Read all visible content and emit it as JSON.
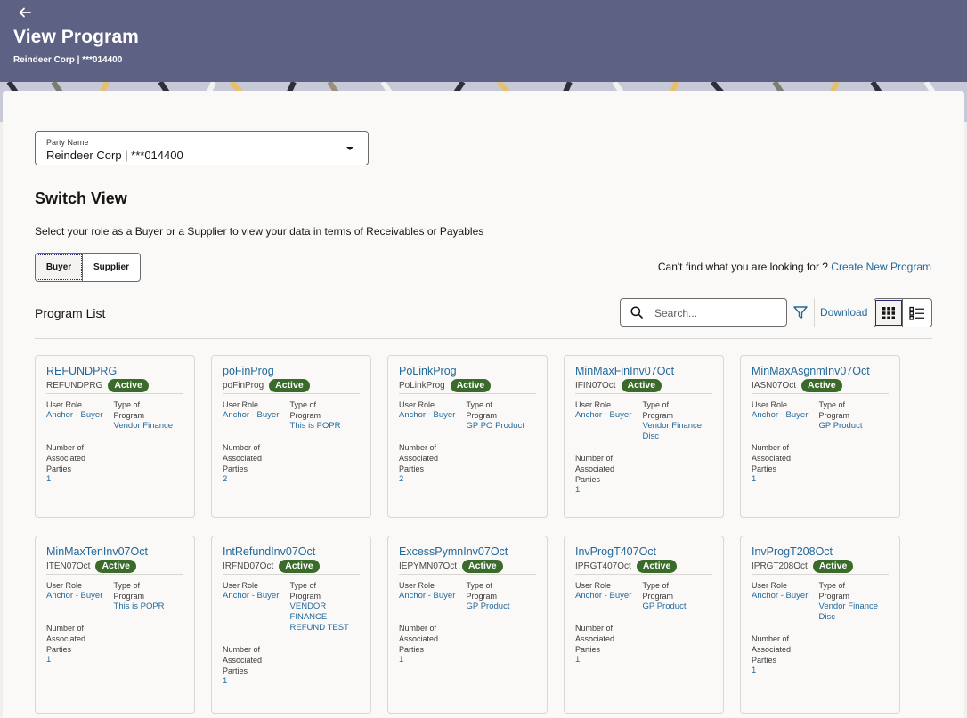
{
  "header": {
    "title": "View Program",
    "subtitle": "Reindeer Corp | ***014400"
  },
  "party": {
    "label": "Party Name",
    "value": "Reindeer Corp | ***014400"
  },
  "switch_view": {
    "title": "Switch View",
    "description": "Select your role as a Buyer or a Supplier to view your data in terms of Receivables or Payables",
    "buyer_label": "Buyer",
    "supplier_label": "Supplier"
  },
  "cant_find": {
    "text": "Can't find what you are looking for ? ",
    "link": "Create New Program"
  },
  "program_list": {
    "title": "Program List",
    "search_placeholder": "Search...",
    "download_label": "Download"
  },
  "labels": {
    "user_role": "User Role",
    "type_line1": "Type of",
    "type_line2": "Program",
    "parties_line1": "Number of",
    "parties_line2": "Associated",
    "parties_line3": "Parties"
  },
  "cards": [
    {
      "name": "REFUNDPRG",
      "code": "REFUNDPRG",
      "status": "Active",
      "role": "Anchor - Buyer",
      "type": "Vendor Finance",
      "parties": "1"
    },
    {
      "name": "poFinProg",
      "code": "poFinProg",
      "status": "Active",
      "role": "Anchor - Buyer",
      "type": "This is POPR",
      "parties": "2"
    },
    {
      "name": "PoLinkProg",
      "code": "PoLinkProg",
      "status": "Active",
      "role": "Anchor - Buyer",
      "type": "GP PO Product",
      "parties": "2"
    },
    {
      "name": "MinMaxFinInv07Oct",
      "code": "IFIN07Oct",
      "status": "Active",
      "role": "Anchor - Buyer",
      "type": "Vendor Finance Disc",
      "parties": "1"
    },
    {
      "name": "MinMaxAsgnmInv07Oct",
      "code": "IASN07Oct",
      "status": "Active",
      "role": "Anchor - Buyer",
      "type": "GP Product",
      "parties": "1"
    },
    {
      "name": "MinMaxTenInv07Oct",
      "code": "ITEN07Oct",
      "status": "Active",
      "role": "Anchor - Buyer",
      "type": "This is POPR",
      "parties": "1"
    },
    {
      "name": "IntRefundInv07Oct",
      "code": "IRFND07Oct",
      "status": "Active",
      "role": "Anchor - Buyer",
      "type": "VENDOR FINANCE REFUND TEST",
      "parties": "1"
    },
    {
      "name": "ExcessPymnInv07Oct",
      "code": "IEPYMN07Oct",
      "status": "Active",
      "role": "Anchor - Buyer",
      "type": "GP Product",
      "parties": "1"
    },
    {
      "name": "InvProgT407Oct",
      "code": "IPRGT407Oct",
      "status": "Active",
      "role": "Anchor - Buyer",
      "type": "GP Product",
      "parties": "1"
    },
    {
      "name": "InvProgT208Oct",
      "code": "IPRGT208Oct",
      "status": "Active",
      "role": "Anchor - Buyer",
      "type": "Vendor Finance Disc",
      "parties": "1"
    }
  ],
  "colors": {
    "header_bg": "#5d6183",
    "link": "#22699a",
    "badge": "#3a6b2a"
  },
  "icons": [
    "back-arrow-icon",
    "search-icon",
    "filter-icon",
    "grid-view-icon",
    "list-view-icon",
    "chevron-down-icon"
  ]
}
